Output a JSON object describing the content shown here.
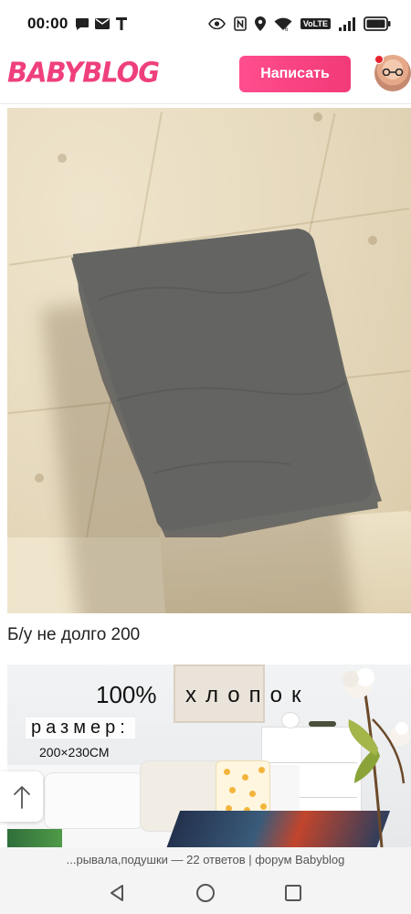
{
  "status_bar": {
    "time": "00:00",
    "left_icons": [
      "chat-bubble-icon",
      "mail-icon",
      "t-icon"
    ],
    "right_icons": [
      "eye-icon",
      "nfc-icon",
      "location-icon",
      "wifi-icon",
      "volte-icon",
      "signal-icon",
      "battery-icon"
    ],
    "volte_label": "VoLTE"
  },
  "header": {
    "logo_text": "BABYBLOG",
    "write_button_label": "Написать",
    "brand_color": "#ef3f7d"
  },
  "post": {
    "image_icon": "gray-pillow-on-cream-sofa-photo",
    "caption": "Б/у не долго 200"
  },
  "product_image": {
    "title_number": "100%",
    "title_word": "хлопок",
    "size_label": "размер:",
    "size_value": "200×230СМ"
  },
  "scroll_up": {
    "icon": "arrow-up-icon"
  },
  "footer": {
    "source_text": "...рывала,подушки — 22 ответов | форум Babyblog"
  },
  "nav_bar": {
    "buttons": [
      "back-icon",
      "home-icon",
      "recents-icon"
    ]
  }
}
